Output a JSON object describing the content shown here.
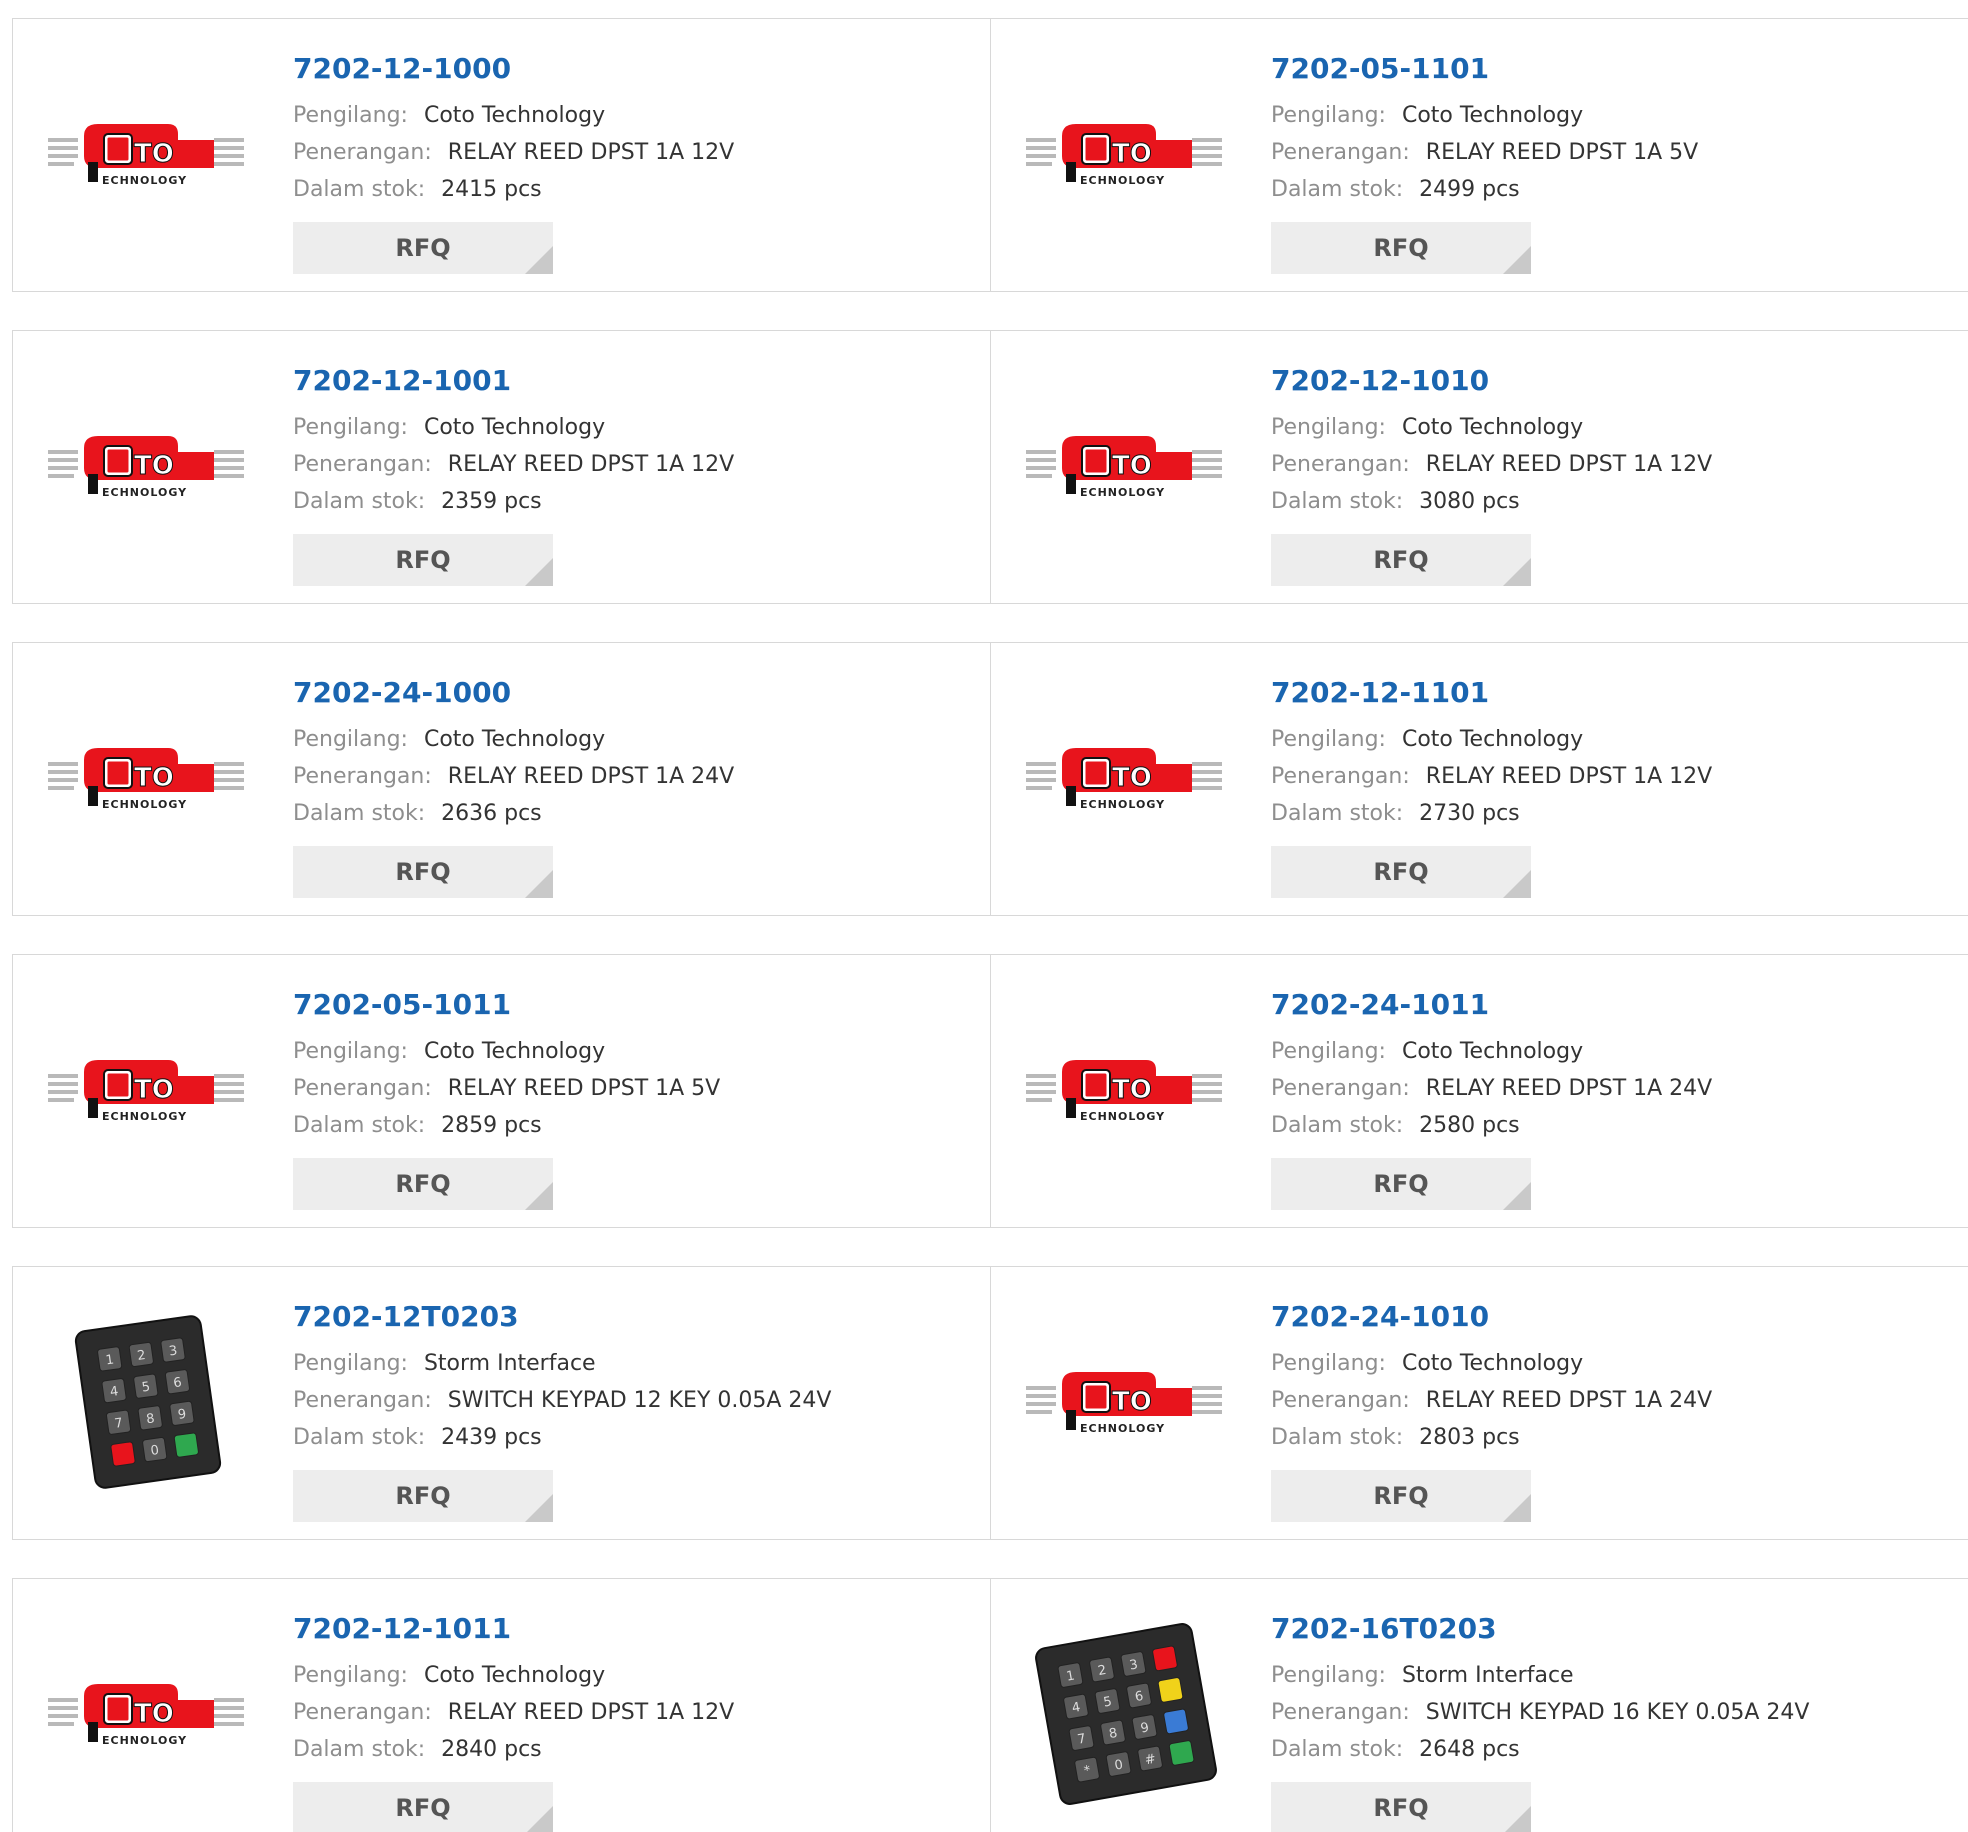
{
  "labels": {
    "manufacturer": "Pengilang:",
    "description": "Penerangan:",
    "stock": "Dalam stok:",
    "rfq": "RFQ"
  },
  "brand_logo_text": {
    "main": "OTO",
    "sub": "ECHNOLOGY"
  },
  "colors": {
    "link": "#1a65b0",
    "label": "#8e8e8e",
    "value": "#333333",
    "button_bg": "#ededed",
    "logo_red": "#e8141c"
  },
  "products": [
    {
      "part": "7202-12-1000",
      "manufacturer": "Coto Technology",
      "description": "RELAY REED DPST 1A 12V",
      "stock": "2415 pcs",
      "image": "coto-logo"
    },
    {
      "part": "7202-05-1101",
      "manufacturer": "Coto Technology",
      "description": "RELAY REED DPST 1A 5V",
      "stock": "2499 pcs",
      "image": "coto-logo"
    },
    {
      "part": "7202-12-1001",
      "manufacturer": "Coto Technology",
      "description": "RELAY REED DPST 1A 12V",
      "stock": "2359 pcs",
      "image": "coto-logo"
    },
    {
      "part": "7202-12-1010",
      "manufacturer": "Coto Technology",
      "description": "RELAY REED DPST 1A 12V",
      "stock": "3080 pcs",
      "image": "coto-logo"
    },
    {
      "part": "7202-24-1000",
      "manufacturer": "Coto Technology",
      "description": "RELAY REED DPST 1A 24V",
      "stock": "2636 pcs",
      "image": "coto-logo"
    },
    {
      "part": "7202-12-1101",
      "manufacturer": "Coto Technology",
      "description": "RELAY REED DPST 1A 12V",
      "stock": "2730 pcs",
      "image": "coto-logo"
    },
    {
      "part": "7202-05-1011",
      "manufacturer": "Coto Technology",
      "description": "RELAY REED DPST 1A 5V",
      "stock": "2859 pcs",
      "image": "coto-logo"
    },
    {
      "part": "7202-24-1011",
      "manufacturer": "Coto Technology",
      "description": "RELAY REED DPST 1A 24V",
      "stock": "2580 pcs",
      "image": "coto-logo"
    },
    {
      "part": "7202-12T0203",
      "manufacturer": "Storm Interface",
      "description": "SWITCH KEYPAD 12 KEY 0.05A 24V",
      "stock": "2439 pcs",
      "image": "keypad-12-image"
    },
    {
      "part": "7202-24-1010",
      "manufacturer": "Coto Technology",
      "description": "RELAY REED DPST 1A 24V",
      "stock": "2803 pcs",
      "image": "coto-logo"
    },
    {
      "part": "7202-12-1011",
      "manufacturer": "Coto Technology",
      "description": "RELAY REED DPST 1A 12V",
      "stock": "2840 pcs",
      "image": "coto-logo"
    },
    {
      "part": "7202-16T0203",
      "manufacturer": "Storm Interface",
      "description": "SWITCH KEYPAD 16 KEY 0.05A 24V",
      "stock": "2648 pcs",
      "image": "keypad-16-image"
    }
  ]
}
